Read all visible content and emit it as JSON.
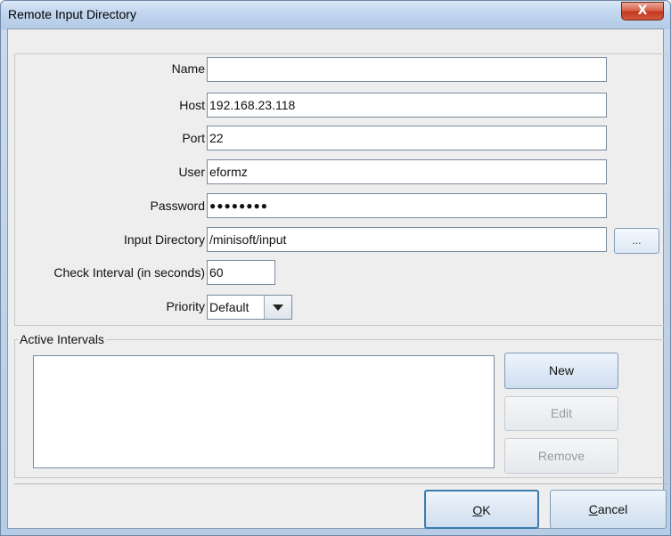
{
  "window": {
    "title": "Remote Input Directory",
    "close_label": "X"
  },
  "form": {
    "name": {
      "label": "Name",
      "value": ""
    },
    "host": {
      "label": "Host",
      "value": "192.168.23.118"
    },
    "port": {
      "label": "Port",
      "value": "22"
    },
    "user": {
      "label": "User",
      "value": "eformz"
    },
    "password": {
      "label": "Password",
      "value": "●●●●●●●●"
    },
    "input_directory": {
      "label": "Input Directory",
      "value": "/minisoft/input",
      "browse_label": "..."
    },
    "check_interval": {
      "label": "Check Interval (in seconds)",
      "value": "60"
    },
    "priority": {
      "label": "Priority",
      "selected": "Default"
    }
  },
  "active_intervals": {
    "title": "Active Intervals",
    "items": [],
    "new_label": "New",
    "edit_label": "Edit",
    "remove_label": "Remove"
  },
  "footer": {
    "ok_mnemonic": "O",
    "ok_rest": "K",
    "cancel_mnemonic": "C",
    "cancel_rest": "ancel"
  },
  "colors": {
    "title_bar": "#c2d6ee",
    "client_bg": "#eeeeee",
    "close_button": "#c2381e",
    "disabled_text": "#9a9a9a"
  }
}
